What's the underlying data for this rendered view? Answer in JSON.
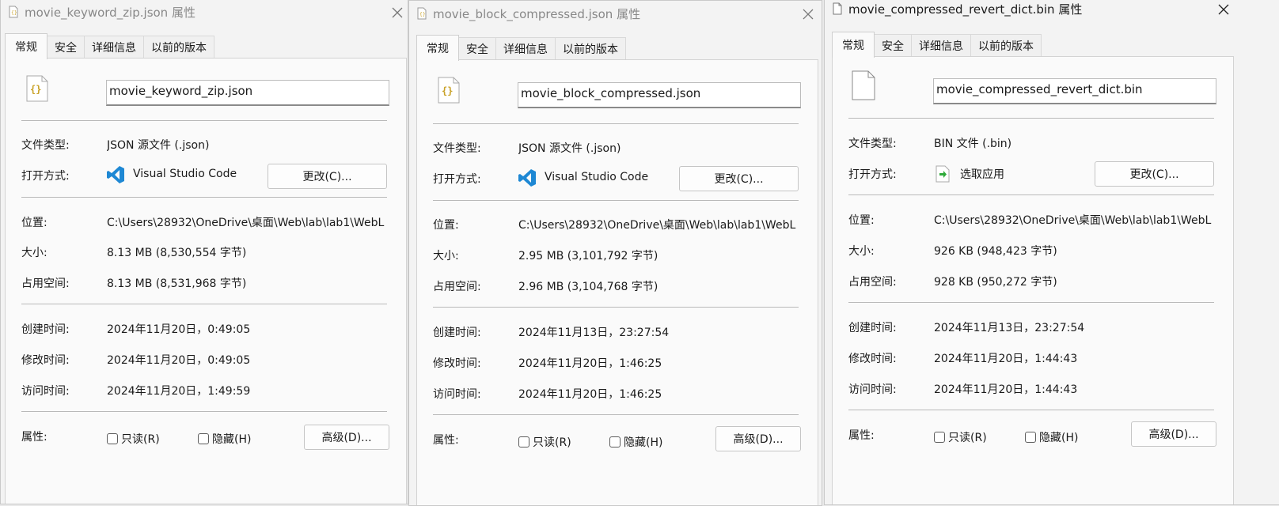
{
  "tabs": [
    "常规",
    "安全",
    "详细信息",
    "以前的版本"
  ],
  "labels": {
    "file_type": "文件类型:",
    "open_with": "打开方式:",
    "location": "位置:",
    "size": "大小:",
    "size_on_disk": "占用空间:",
    "created": "创建时间:",
    "modified": "修改时间:",
    "accessed": "访问时间:",
    "attributes": "属性:"
  },
  "buttons": {
    "change": "更改(C)...",
    "advanced": "高级(D)..."
  },
  "checkboxes": {
    "readonly": "只读(R)",
    "hidden": "隐藏(H)"
  },
  "windows": [
    {
      "title": "movie_keyword_zip.json 属性",
      "name": "movie_keyword_zip.json",
      "file_type": "JSON 源文件 (.json)",
      "open_with": "Visual Studio Code",
      "location": "C:\\Users\\28932\\OneDrive\\桌面\\Web\\lab\\lab1\\WebL",
      "size": "8.13 MB (8,530,554 字节)",
      "size_on_disk": "8.13 MB (8,531,968 字节)",
      "created": "2024年11月20日，0:49:05",
      "modified": "2024年11月20日，0:49:05",
      "accessed": "2024年11月20日，1:49:59"
    },
    {
      "title": "movie_block_compressed.json 属性",
      "name": "movie_block_compressed.json",
      "file_type": "JSON 源文件 (.json)",
      "open_with": "Visual Studio Code",
      "location": "C:\\Users\\28932\\OneDrive\\桌面\\Web\\lab\\lab1\\WebL",
      "size": "2.95 MB (3,101,792 字节)",
      "size_on_disk": "2.96 MB (3,104,768 字节)",
      "created": "2024年11月13日，23:27:54",
      "modified": "2024年11月20日，1:46:25",
      "accessed": "2024年11月20日，1:46:25"
    },
    {
      "title": "movie_compressed_revert_dict.bin 属性",
      "name": "movie_compressed_revert_dict.bin",
      "file_type": "BIN 文件 (.bin)",
      "open_with": "选取应用",
      "location": "C:\\Users\\28932\\OneDrive\\桌面\\Web\\lab\\lab1\\WebL",
      "size": "926 KB (948,423 字节)",
      "size_on_disk": "928 KB (950,272 字节)",
      "created": "2024年11月13日，23:27:54",
      "modified": "2024年11月20日，1:44:43",
      "accessed": "2024年11月20日，1:44:43"
    }
  ],
  "colors": {
    "json_icon": "#c9a227",
    "vscode": "#1e88d4",
    "pick_app": "#2faa3a"
  },
  "icons": {
    "json_file": "json-file-icon",
    "bin_file": "blank-file-icon",
    "vscode": "vscode-icon",
    "pick_app": "pick-app-icon"
  }
}
